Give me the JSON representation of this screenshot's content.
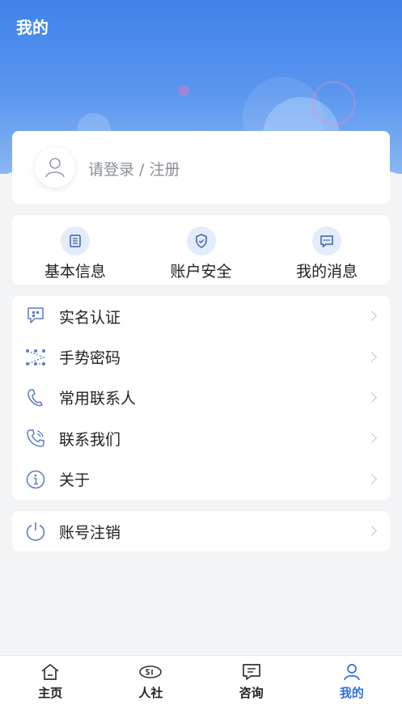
{
  "header": {
    "title": "我的"
  },
  "login": {
    "prompt": "请登录 / 注册"
  },
  "quick_actions": [
    {
      "label": "基本信息",
      "icon": "document-list-icon"
    },
    {
      "label": "账户安全",
      "icon": "shield-check-icon"
    },
    {
      "label": "我的消息",
      "icon": "chat-bubble-icon"
    }
  ],
  "menu": [
    {
      "label": "实名认证",
      "icon": "id-verify-icon"
    },
    {
      "label": "手势密码",
      "icon": "gesture-pattern-icon"
    },
    {
      "label": "常用联系人",
      "icon": "contacts-icon"
    },
    {
      "label": "联系我们",
      "icon": "phone-icon"
    },
    {
      "label": "关于",
      "icon": "info-icon"
    }
  ],
  "logout": {
    "label": "账号注销",
    "icon": "power-icon"
  },
  "tabbar": [
    {
      "label": "主页",
      "icon": "home-icon",
      "active": false
    },
    {
      "label": "人社",
      "icon": "si-logo-icon",
      "active": false
    },
    {
      "label": "咨询",
      "icon": "message-icon",
      "active": false
    },
    {
      "label": "我的",
      "icon": "user-icon",
      "active": true
    }
  ],
  "colors": {
    "primary": "#3f83ea",
    "active_tab": "#2f6fdd",
    "icon_blue": "#4a74c9"
  }
}
